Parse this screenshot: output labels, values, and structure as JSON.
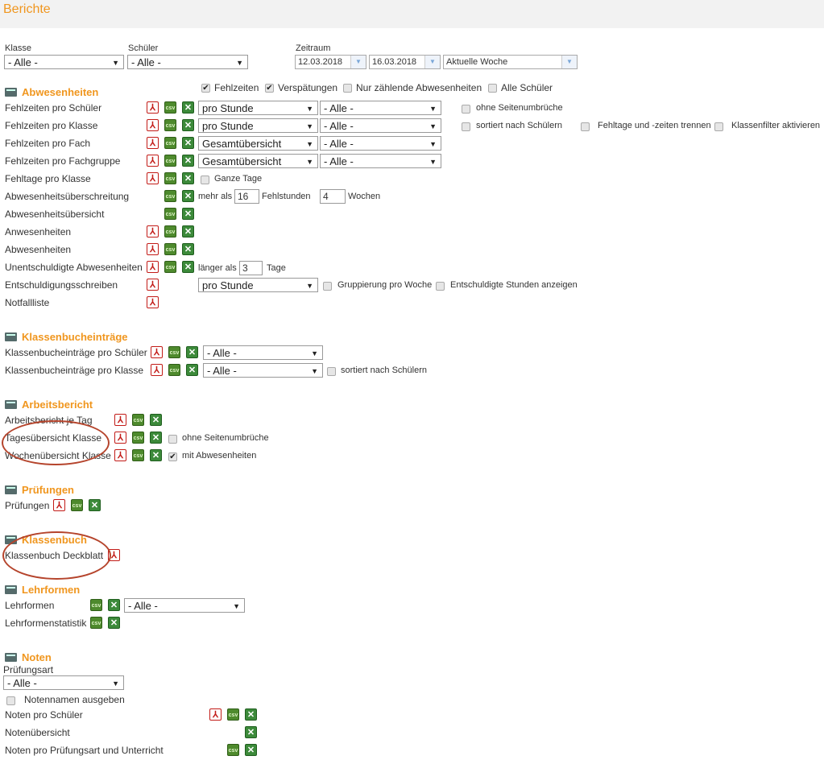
{
  "page": {
    "title": "Berichte"
  },
  "filters": {
    "klasse": {
      "label": "Klasse",
      "value": "- Alle -"
    },
    "schueler": {
      "label": "Schüler",
      "value": "- Alle -"
    },
    "zeitraum": {
      "label": "Zeitraum",
      "from": "12.03.2018",
      "to": "16.03.2018",
      "preset": "Aktuelle Woche"
    }
  },
  "abwesenheiten": {
    "title": "Abwesenheiten",
    "opt_fehlzeiten": "Fehlzeiten",
    "opt_verspaetungen": "Verspätungen",
    "opt_nur_zaehlende": "Nur zählende Abwesenheiten",
    "opt_alle_schueler": "Alle Schüler",
    "rows": [
      {
        "label": "Fehlzeiten pro Schüler",
        "sel1": "pro Stunde",
        "sel2": "- Alle -",
        "opt": "ohne Seitenumbrüche"
      },
      {
        "label": "Fehlzeiten pro Klasse",
        "sel1": "pro Stunde",
        "sel2": "- Alle -",
        "opt": "sortiert nach Schülern",
        "opt2": "Fehltage und -zeiten trennen",
        "opt3": "Klassenfilter aktivieren"
      },
      {
        "label": "Fehlzeiten pro Fach",
        "sel1": "Gesamtübersicht",
        "sel2": "- Alle -"
      },
      {
        "label": "Fehlzeiten pro Fachgruppe",
        "sel1": "Gesamtübersicht",
        "sel2": "- Alle -"
      },
      {
        "label": "Fehltage pro Klasse",
        "opt": "Ganze Tage"
      },
      {
        "label": "Abwesenheitsüberschreitung",
        "pre": "mehr als",
        "val1": "16",
        "mid": "Fehlstunden",
        "val2": "4",
        "post": "Wochen"
      },
      {
        "label": "Abwesenheitsübersicht"
      },
      {
        "label": "Anwesenheiten"
      },
      {
        "label": "Abwesenheiten"
      },
      {
        "label": "Unentschuldigte Abwesenheiten",
        "pre": "länger als",
        "val1": "3",
        "post": "Tage"
      },
      {
        "label": "Entschuldigungsschreiben",
        "sel1": "pro Stunde",
        "opt": "Gruppierung pro Woche",
        "opt2": "Entschuldigte Stunden anzeigen"
      },
      {
        "label": "Notfallliste"
      }
    ]
  },
  "klassenbucheintraege": {
    "title": "Klassenbucheinträge",
    "rows": [
      {
        "label": "Klassenbucheinträge pro Schüler",
        "sel": "- Alle -"
      },
      {
        "label": "Klassenbucheinträge pro Klasse",
        "sel": "- Alle -",
        "opt": "sortiert nach Schülern"
      }
    ]
  },
  "arbeitsbericht": {
    "title": "Arbeitsbericht",
    "rows": [
      {
        "label": "Arbeitsbericht je Tag"
      },
      {
        "label": "Tagesübersicht Klasse",
        "opt": "ohne Seitenumbrüche"
      },
      {
        "label": "Wochenübersicht Klasse",
        "opt": "mit Abwesenheiten"
      }
    ]
  },
  "pruefungen": {
    "title": "Prüfungen",
    "rows": [
      {
        "label": "Prüfungen"
      }
    ]
  },
  "klassenbuch": {
    "title": "Klassenbuch",
    "rows": [
      {
        "label": "Klassenbuch Deckblatt"
      }
    ]
  },
  "lehrformen": {
    "title": "Lehrformen",
    "rows": [
      {
        "label": "Lehrformen",
        "sel": "- Alle -"
      },
      {
        "label": "Lehrformenstatistik"
      }
    ]
  },
  "noten": {
    "title": "Noten",
    "pruefungsart_label": "Prüfungsart",
    "pruefungsart_value": "- Alle -",
    "opt_notennamen": "Notennamen ausgeben",
    "rows": [
      {
        "label": "Noten pro Schüler"
      },
      {
        "label": "Notenübersicht"
      },
      {
        "label": "Noten pro Prüfungsart und Unterricht"
      }
    ]
  },
  "icons": {
    "pdf": "PDF",
    "csv": "csv",
    "xls": "X",
    "check": "✔",
    "dropdown": "▼"
  }
}
